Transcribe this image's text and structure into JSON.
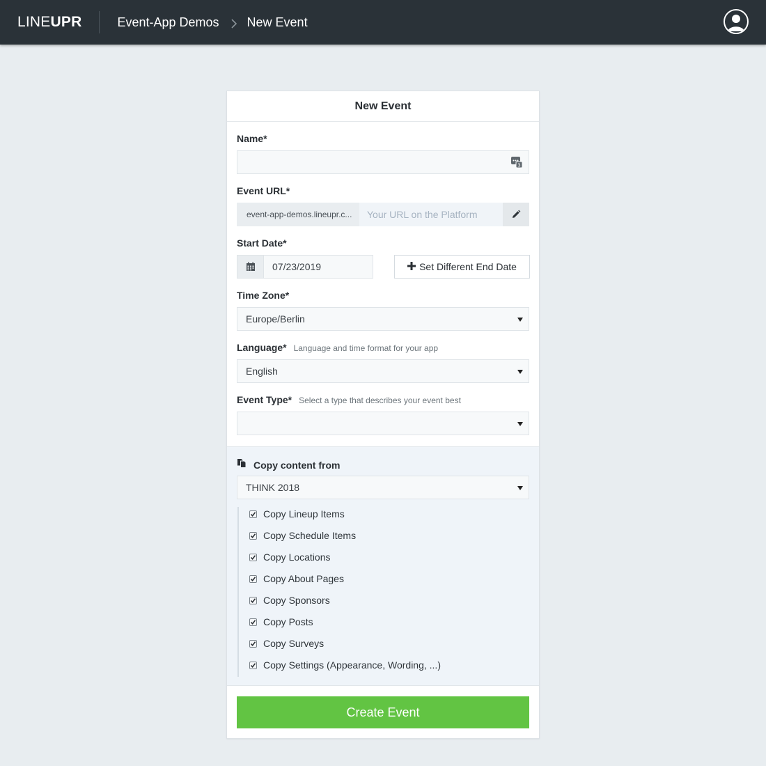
{
  "header": {
    "logo_light": "LINE",
    "logo_bold": "UPR",
    "breadcrumb_parent": "Event-App Demos",
    "breadcrumb_current": "New Event"
  },
  "form": {
    "title": "New Event",
    "name_label": "Name*",
    "name_value": "",
    "event_url_label": "Event URL*",
    "url_prefix": "event-app-demos.lineupr.c...",
    "url_placeholder": "Your URL on the Platform",
    "start_date_label": "Start Date*",
    "start_date_value": "07/23/2019",
    "end_date_button": "Set Different End Date",
    "time_zone_label": "Time Zone*",
    "time_zone_value": "Europe/Berlin",
    "language_label": "Language*",
    "language_hint": "Language and time format for your app",
    "language_value": "English",
    "event_type_label": "Event Type*",
    "event_type_hint": "Select a type that describes your event best",
    "event_type_value": ""
  },
  "copy": {
    "title": "Copy content from",
    "source_value": "THINK 2018",
    "options": [
      {
        "label": "Copy Lineup Items",
        "checked": true
      },
      {
        "label": "Copy Schedule Items",
        "checked": true
      },
      {
        "label": "Copy Locations",
        "checked": true
      },
      {
        "label": "Copy About Pages",
        "checked": true
      },
      {
        "label": "Copy Sponsors",
        "checked": true
      },
      {
        "label": "Copy Posts",
        "checked": true
      },
      {
        "label": "Copy Surveys",
        "checked": true
      },
      {
        "label": "Copy Settings (Appearance, Wording, ...)",
        "checked": true
      }
    ]
  },
  "submit_label": "Create Event",
  "colors": {
    "topbar": "#2a3238",
    "primary_button": "#62c443",
    "background": "#e8edf0"
  },
  "icons": [
    "user-avatar-icon",
    "chevron-right-icon",
    "translate-icon",
    "pencil-icon",
    "calendar-icon",
    "plus-icon",
    "copy-icon",
    "checkbox-checked-icon",
    "dropdown-caret-icon"
  ]
}
